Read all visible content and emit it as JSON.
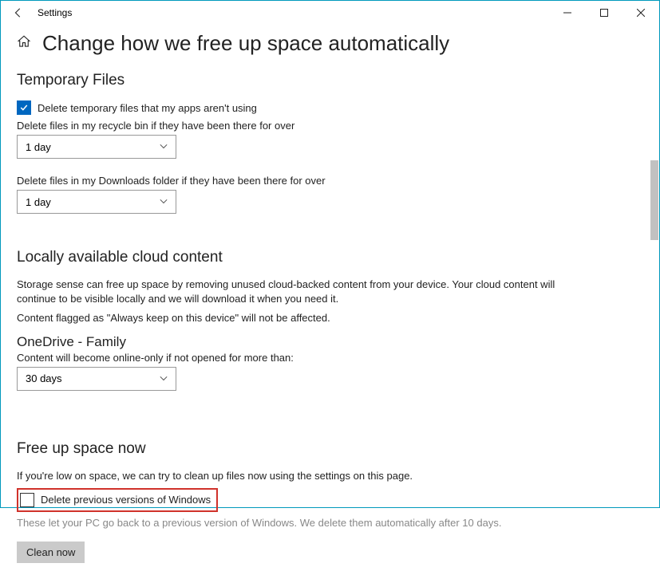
{
  "titlebar": {
    "title": "Settings"
  },
  "page": {
    "title": "Change how we free up space automatically"
  },
  "tempFiles": {
    "heading": "Temporary Files",
    "checkbox_label": "Delete temporary files that my apps aren't using",
    "recycle_label": "Delete files in my recycle bin if they have been there for over",
    "recycle_value": "1 day",
    "downloads_label": "Delete files in my Downloads folder if they have been there for over",
    "downloads_value": "1 day"
  },
  "cloud": {
    "heading": "Locally available cloud content",
    "desc1": "Storage sense can free up space by removing unused cloud-backed content from your device. Your cloud content will continue to be visible locally and we will download it when you need it.",
    "desc2": "Content flagged as \"Always keep on this device\" will not be affected.",
    "onedrive_title": "OneDrive - Family",
    "onedrive_label": "Content will become online-only if not opened for more than:",
    "onedrive_value": "30 days"
  },
  "freeup": {
    "heading": "Free up space now",
    "desc": "If you're low on space, we can try to clean up files now using the settings on this page.",
    "checkbox_label": "Delete previous versions of Windows",
    "hint": "These let your PC go back to a previous version of Windows. We delete them automatically after 10 days.",
    "clean_button": "Clean now"
  }
}
